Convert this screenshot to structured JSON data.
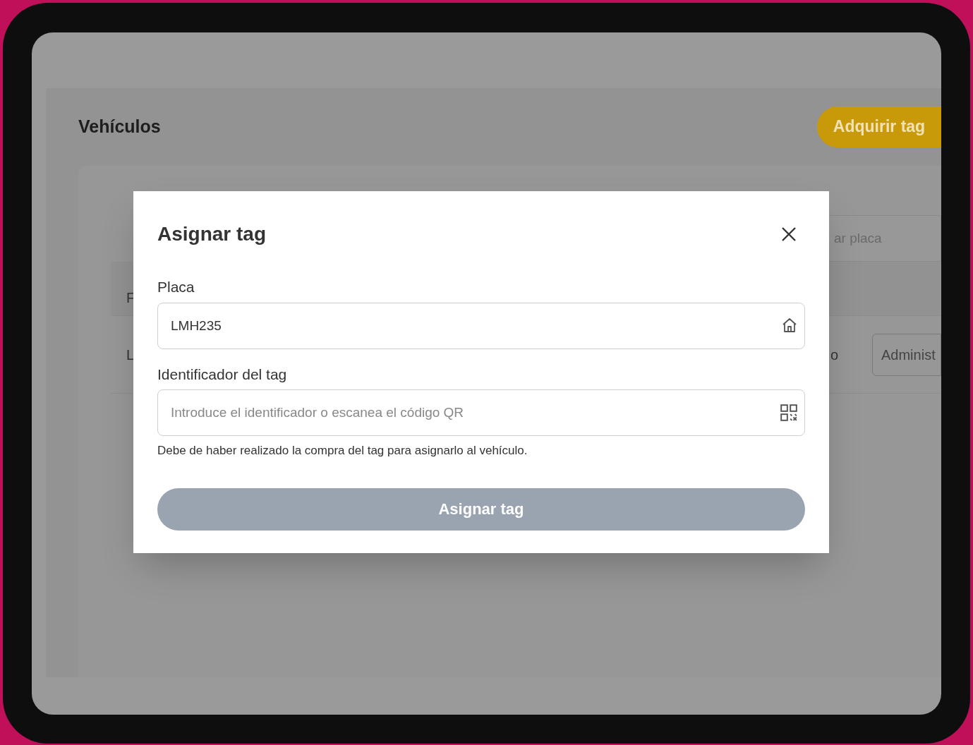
{
  "page": {
    "title": "Vehículos",
    "buy_button": "Adquirir tag",
    "search_placeholder": "ar placa",
    "column_1": "F",
    "cell_1": "L",
    "cell_2": "o",
    "role_button": "Administ"
  },
  "dialog": {
    "title": "Asignar tag",
    "fields": [
      {
        "label": "Placa",
        "value": "LMH235"
      },
      {
        "label": "Identificador del tag",
        "placeholder": "Introduce el identificador o escanea el código QR"
      }
    ],
    "hint": "Debe de haber realizado la compra del tag para asignarlo al vehículo.",
    "submit": {
      "label": "Asignar tag",
      "disabled": true
    }
  }
}
